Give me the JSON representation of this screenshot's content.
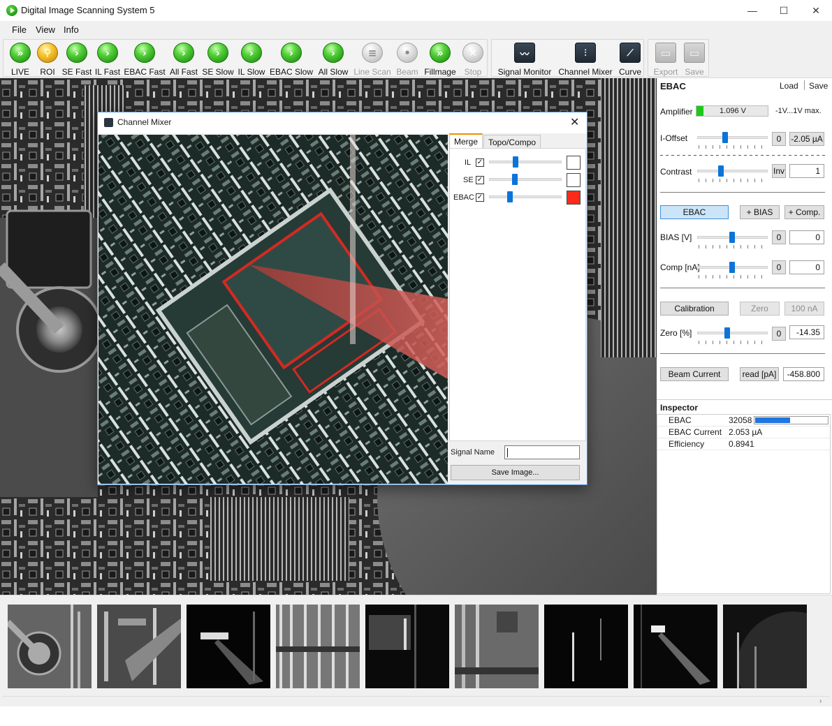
{
  "window": {
    "title": "Digital Image Scanning System 5",
    "minimize": "—",
    "maximize": "☐",
    "close": "✕"
  },
  "menu": [
    "File",
    "View",
    "Info"
  ],
  "toolbar": {
    "scan_buttons": [
      {
        "label": "LIVE",
        "icon": "double-play-icon",
        "color": "green"
      },
      {
        "label": "ROI",
        "icon": "magnifier-icon",
        "color": "orange"
      },
      {
        "label": "SE Fast",
        "icon": "play-icon",
        "color": "green"
      },
      {
        "label": "IL Fast",
        "icon": "play-icon",
        "color": "green"
      },
      {
        "label": "EBAC Fast",
        "icon": "play-icon",
        "color": "green"
      },
      {
        "label": "All Fast",
        "icon": "play-icon",
        "color": "green"
      },
      {
        "label": "SE Slow",
        "icon": "play-icon",
        "color": "green"
      },
      {
        "label": "IL Slow",
        "icon": "play-icon",
        "color": "green"
      },
      {
        "label": "EBAC Slow",
        "icon": "play-icon",
        "color": "green"
      },
      {
        "label": "All Slow",
        "icon": "play-icon",
        "color": "green"
      },
      {
        "label": "Line Scan",
        "icon": "line-scan-icon",
        "color": "grey"
      },
      {
        "label": "Beam",
        "icon": "beam-icon",
        "color": "grey"
      },
      {
        "label": "Fillmage",
        "icon": "double-play-icon",
        "color": "green"
      },
      {
        "label": "Stop",
        "icon": "stop-icon",
        "color": "grey"
      }
    ],
    "tool_buttons": [
      {
        "label": "Signal Monitor",
        "icon": "signal-monitor-icon"
      },
      {
        "label": "Channel Mixer",
        "icon": "channel-mixer-icon"
      },
      {
        "label": "Curve",
        "icon": "curve-icon"
      }
    ],
    "file_buttons": [
      {
        "label": "Export",
        "icon": "floppy-icon"
      },
      {
        "label": "Save",
        "icon": "floppy-icon"
      }
    ]
  },
  "ebac_panel": {
    "title": "EBAC",
    "load": "Load",
    "save": "Save",
    "amplifier_label": "Amplifier",
    "amplifier_value": "1.096 V",
    "amplifier_range": "-1V...1V max.",
    "ioffset_label": "I-Offset",
    "ioffset_zero": "0",
    "ioffset_value": "-2.05 µA",
    "contrast_label": "Contrast",
    "contrast_inv": "Inv",
    "contrast_value": "1",
    "mode_ebac": "EBAC",
    "mode_bias": "+ BIAS",
    "mode_comp": "+ Comp.",
    "bias_label": "BIAS [V]",
    "bias_zero": "0",
    "bias_value": "0",
    "comp_label": "Comp [nA]",
    "comp_zero": "0",
    "comp_value": "0",
    "calibration": "Calibration",
    "zero_btn": "Zero",
    "hundred_btn": "100 nA",
    "zero_label": "Zero [%]",
    "zero_zero": "0",
    "zero_value": "-14.35",
    "beam_current": "Beam Current",
    "read_btn": "read [pA]",
    "beam_value": "-458.800"
  },
  "inspector": {
    "title": "Inspector",
    "rows": [
      {
        "name": "EBAC",
        "value": "32058",
        "bar_fraction": 0.49
      },
      {
        "name": "EBAC Current",
        "value": "2.053 µA"
      },
      {
        "name": "Efficiency",
        "value": "0.8941"
      }
    ]
  },
  "mixer": {
    "title": "Channel Mixer",
    "tabs": [
      "Merge",
      "Topo/Compo"
    ],
    "channels": [
      {
        "name": "IL",
        "checked": true,
        "level": 0.36,
        "color": "#ffffff"
      },
      {
        "name": "SE",
        "checked": true,
        "level": 0.35,
        "color": "#ffffff"
      },
      {
        "name": "EBAC",
        "checked": true,
        "level": 0.28,
        "color": "#ff2a1a"
      }
    ],
    "signal_name_label": "Signal Name",
    "signal_name_value": "",
    "save_image": "Save Image..."
  },
  "colors": {
    "accent": "#0a74d8",
    "ebac_red": "#ff2a1a",
    "amplifier_green": "#1ec81a"
  }
}
